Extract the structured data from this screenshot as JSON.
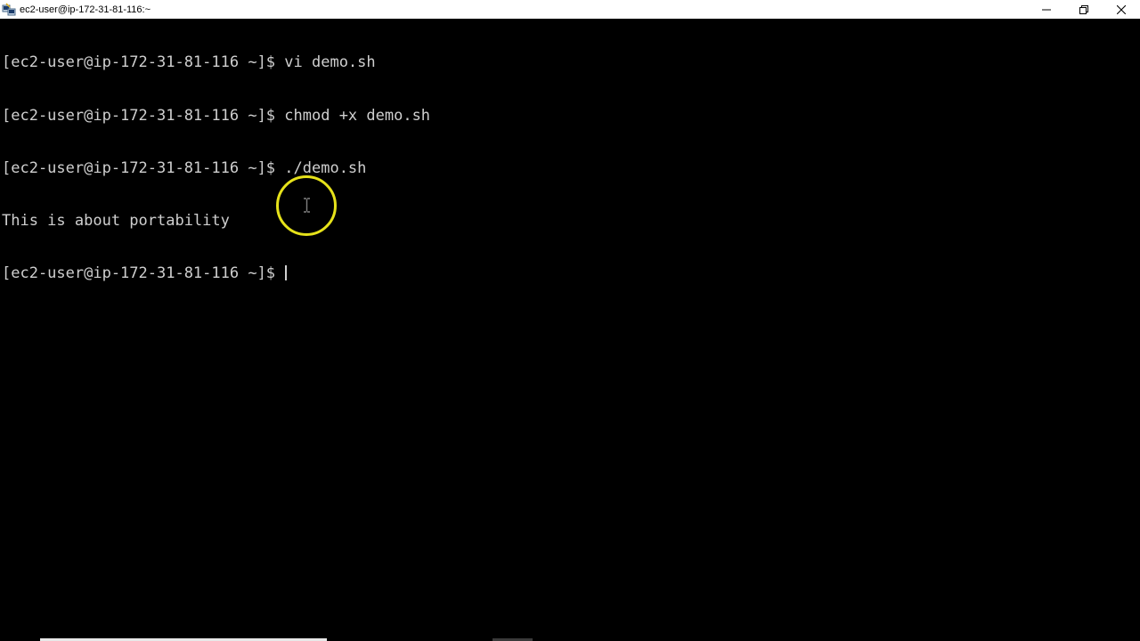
{
  "window": {
    "title": "ec2-user@ip-172-31-81-116:~"
  },
  "terminal": {
    "lines": [
      "[ec2-user@ip-172-31-81-116 ~]$ vi demo.sh",
      "[ec2-user@ip-172-31-81-116 ~]$ chmod +x demo.sh",
      "[ec2-user@ip-172-31-81-116 ~]$ ./demo.sh",
      "This is about portability"
    ],
    "prompt": "[ec2-user@ip-172-31-81-116 ~]$ ",
    "text_color": "#cfcfcf",
    "background_color": "#000000"
  },
  "overlay": {
    "highlight_color": "#e6e21a"
  },
  "icons": {
    "app": "putty-icon",
    "minimize": "minimize-icon",
    "restore": "restore-icon",
    "close": "close-icon",
    "pointer": "ibeam-cursor-icon"
  }
}
